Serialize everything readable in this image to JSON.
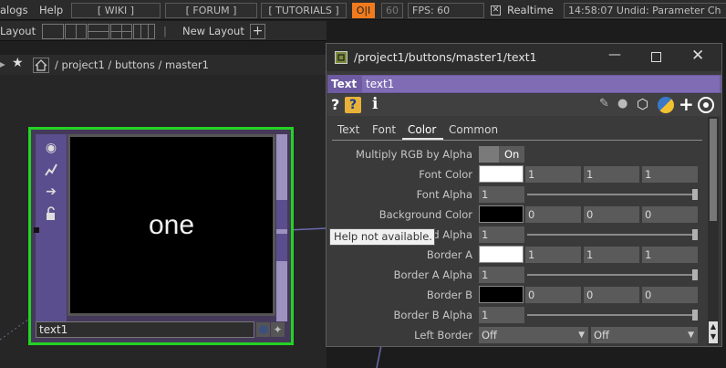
{
  "topbar": {
    "menu_dialogs": "alogs",
    "menu_help": "Help",
    "wiki": "[ WIKI ]",
    "forum": "[ FORUM ]",
    "tutorials": "[ TUTORIALS ]",
    "oi": "O|I",
    "fps_target": "60",
    "fps": "FPS:  60",
    "realtime": "Realtime",
    "status": "14:58:07 Undid: Parameter Ch"
  },
  "layoutbar": {
    "label": "Layout",
    "new_layout": "New Layout"
  },
  "pathbar": {
    "path": "/ project1 / buttons / master1"
  },
  "node": {
    "display_text": "one",
    "name": "text1"
  },
  "tooltip": "Help not available.",
  "panel": {
    "title": "/project1/buttons/master1/text1",
    "op_type": "Text",
    "op_name": "text1",
    "tabs": [
      "Text",
      "Font",
      "Color",
      "Common"
    ],
    "active_tab": "Color",
    "params": [
      {
        "label": "Multiply RGB by Alpha",
        "toggle": "On"
      },
      {
        "label": "Font Color",
        "swatch": "#ffffff",
        "values": [
          "1",
          "1",
          "1"
        ]
      },
      {
        "label": "Font Alpha",
        "slider_value": "1",
        "level": 1.0
      },
      {
        "label": "Background Color",
        "swatch": "#000000",
        "values": [
          "0",
          "0",
          "0"
        ]
      },
      {
        "label": "d Alpha",
        "slider_value": "1",
        "level": 1.0
      },
      {
        "label": "Border A",
        "swatch": "#ffffff",
        "values": [
          "1",
          "1",
          "1"
        ]
      },
      {
        "label": "Border A Alpha",
        "slider_value": "1",
        "level": 1.0
      },
      {
        "label": "Border B",
        "swatch": "#000000",
        "values": [
          "0",
          "0",
          "0"
        ]
      },
      {
        "label": "Border B Alpha",
        "slider_value": "1",
        "level": 1.0
      },
      {
        "label": "Left Border",
        "menus": [
          "Off",
          "Off"
        ]
      }
    ]
  },
  "colors": {
    "node_outline": "#23d323",
    "accent_orange": "#f07b1e",
    "purple_bar": "#5b4e8e"
  }
}
